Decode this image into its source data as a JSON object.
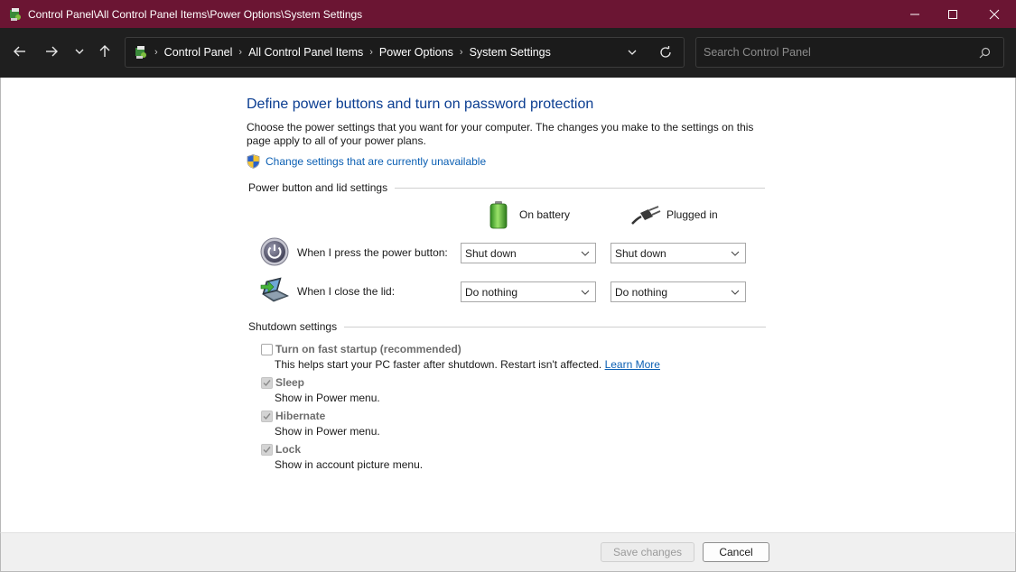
{
  "window": {
    "title": "Control Panel\\All Control Panel Items\\Power Options\\System Settings"
  },
  "nav": {
    "breadcrumbs": [
      "Control Panel",
      "All Control Panel Items",
      "Power Options",
      "System Settings"
    ],
    "search_placeholder": "Search Control Panel"
  },
  "main": {
    "title": "Define power buttons and turn on password protection",
    "description": "Choose the power settings that you want for your computer. The changes you make to the settings on this page apply to all of your power plans.",
    "change_link": "Change settings that are currently unavailable",
    "power_section": {
      "heading": "Power button and lid settings",
      "col_battery": "On battery",
      "col_plugged": "Plugged in",
      "rows": [
        {
          "label": "When I press the power button:",
          "battery": "Shut down",
          "plugged": "Shut down"
        },
        {
          "label": "When I close the lid:",
          "battery": "Do nothing",
          "plugged": "Do nothing"
        }
      ]
    },
    "shutdown_section": {
      "heading": "Shutdown settings",
      "items": [
        {
          "title": "Turn on fast startup (recommended)",
          "desc": "This helps start your PC faster after shutdown. Restart isn't affected.",
          "link": "Learn More",
          "checked": false
        },
        {
          "title": "Sleep",
          "desc": "Show in Power menu.",
          "checked": true
        },
        {
          "title": "Hibernate",
          "desc": "Show in Power menu.",
          "checked": true
        },
        {
          "title": "Lock",
          "desc": "Show in account picture menu.",
          "checked": true
        }
      ]
    }
  },
  "footer": {
    "save_label": "Save changes",
    "cancel_label": "Cancel"
  },
  "colors": {
    "titlebar": "#6b1533",
    "navbar": "#1f1f1f",
    "heading_blue": "#0a3d91",
    "link_blue": "#0b5fb3"
  }
}
